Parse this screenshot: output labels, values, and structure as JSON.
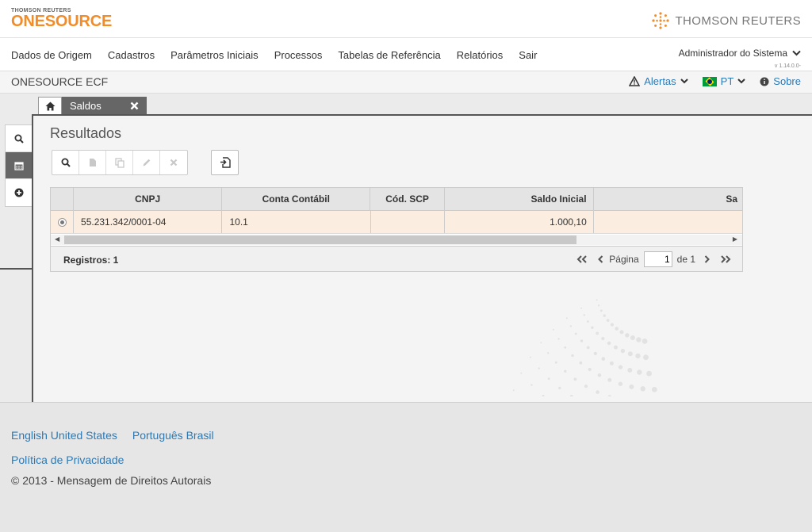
{
  "header": {
    "brand_small": "THOMSON REUTERS",
    "brand_big": "ONESOURCE",
    "tr_brand": "THOMSON REUTERS"
  },
  "nav": {
    "items": [
      "Dados de Origem",
      "Cadastros",
      "Parâmetros Iniciais",
      "Processos",
      "Tabelas de Referência",
      "Relatórios",
      "Sair"
    ],
    "user": "Administrador do Sistema",
    "version": "v 1.14.0.0-"
  },
  "subheader": {
    "app_title": "ONESOURCE ECF",
    "alerts": "Alertas",
    "language": "PT",
    "about": "Sobre"
  },
  "tabs": {
    "active_label": "Saldos"
  },
  "results": {
    "title": "Resultados"
  },
  "grid": {
    "columns": [
      "CNPJ",
      "Conta Contábil",
      "Cód. SCP",
      "Saldo Inicial",
      "Sa"
    ],
    "rows": [
      {
        "cnpj": "55.231.342/0001-04",
        "conta": "10.1",
        "scp": "",
        "saldo_inicial": "1.000,10",
        "extra": ""
      }
    ],
    "records_label": "Registros: 1",
    "page_label": "Página",
    "page_value": "1",
    "page_of": "de 1"
  },
  "footer": {
    "lang_en": "English United States",
    "lang_pt": "Português Brasil",
    "privacy": "Política de Privacidade",
    "copyright": "© 2013 - Mensagem de Direitos Autorais"
  },
  "colors": {
    "brand_orange": "#f28c28",
    "link_blue": "#2a7ab8",
    "selected_row": "#fbeee0"
  }
}
